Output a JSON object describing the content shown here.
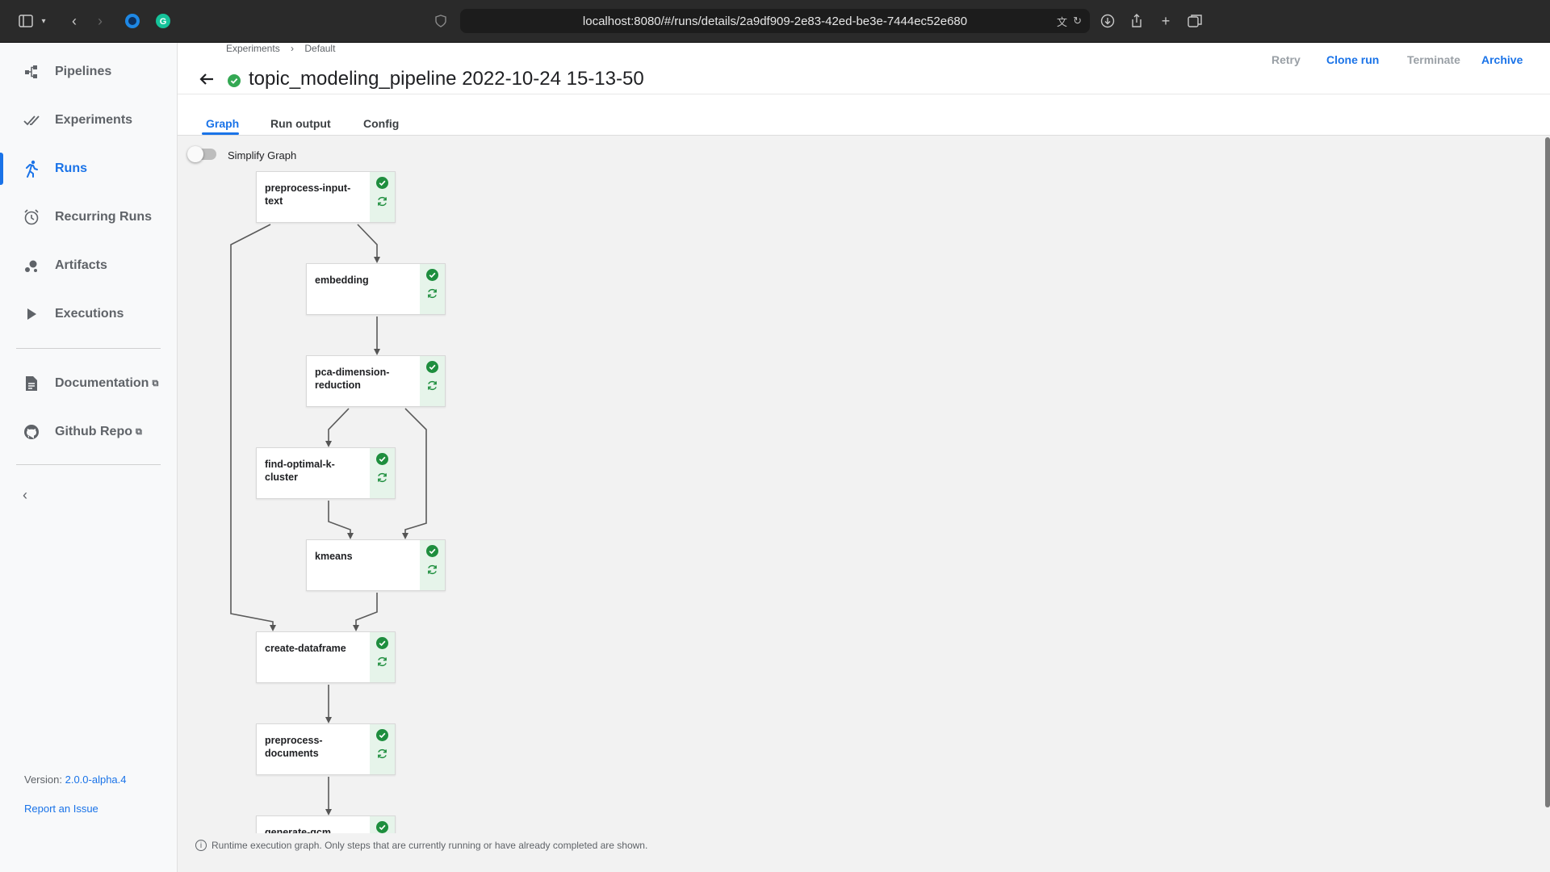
{
  "browser": {
    "url": "localhost:8080/#/runs/details/2a9df909-2e83-42ed-be3e-7444ec52e680"
  },
  "sidebar": {
    "items": [
      {
        "label": "Pipelines",
        "icon": "pipelines-icon"
      },
      {
        "label": "Experiments",
        "icon": "experiments-icon"
      },
      {
        "label": "Runs",
        "icon": "runs-icon",
        "active": true
      },
      {
        "label": "Recurring Runs",
        "icon": "alarm-icon"
      },
      {
        "label": "Artifacts",
        "icon": "artifacts-icon"
      },
      {
        "label": "Executions",
        "icon": "play-icon"
      }
    ],
    "links": [
      {
        "label": "Documentation",
        "icon": "document-icon"
      },
      {
        "label": "Github Repo",
        "icon": "github-icon"
      }
    ],
    "version_label": "Version:",
    "version_value": "2.0.0-alpha.4",
    "report_issue": "Report an Issue"
  },
  "breadcrumb": {
    "items": [
      "Experiments",
      "Default"
    ],
    "separator": "›"
  },
  "header": {
    "title": "topic_modeling_pipeline 2022-10-24 15-13-50",
    "status": "succeeded",
    "actions": {
      "retry": "Retry",
      "clone": "Clone run",
      "terminate": "Terminate",
      "archive": "Archive"
    }
  },
  "tabs": [
    "Graph",
    "Run output",
    "Config"
  ],
  "graph": {
    "simplify_label": "Simplify Graph",
    "simplify_enabled": false,
    "nodes": [
      {
        "name": "preprocess-input-text",
        "label": "preprocess-input-\ntext",
        "status": "succeeded"
      },
      {
        "name": "embedding",
        "label": "embedding",
        "status": "succeeded"
      },
      {
        "name": "pca-dimension-reduction",
        "label": "pca-dimension-\nreduction",
        "status": "succeeded"
      },
      {
        "name": "find-optimal-k-cluster",
        "label": "find-optimal-k-\ncluster",
        "status": "succeeded"
      },
      {
        "name": "kmeans",
        "label": "kmeans",
        "status": "succeeded"
      },
      {
        "name": "create-dataframe",
        "label": "create-dataframe",
        "status": "succeeded"
      },
      {
        "name": "preprocess-documents",
        "label": "preprocess-\ndocuments",
        "status": "succeeded"
      },
      {
        "name": "generate-qcm",
        "label": "generate-qcm",
        "status": "succeeded"
      }
    ],
    "info_text": "Runtime execution graph. Only steps that are currently running or have already completed are shown."
  },
  "colors": {
    "accent": "#1a73e8",
    "success": "#34a853",
    "success_strip": "#e6f4ea",
    "disabled_action": "#9aa0a6"
  }
}
